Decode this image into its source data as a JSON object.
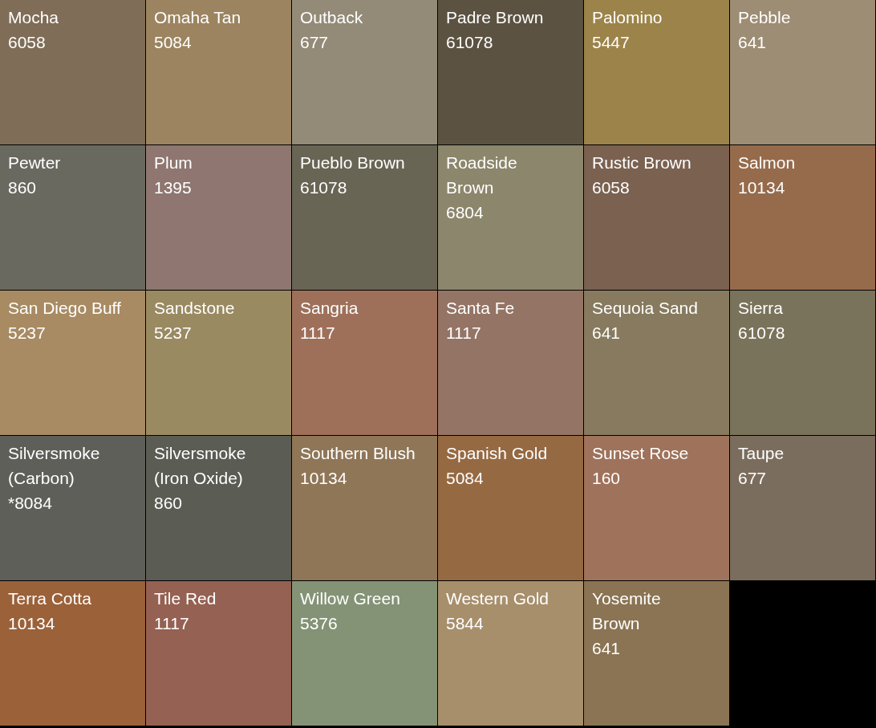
{
  "swatches": [
    {
      "name": "Mocha",
      "code": "6058",
      "color": "#7f6d57"
    },
    {
      "name": "Omaha Tan",
      "code": "5084",
      "color": "#9c8460"
    },
    {
      "name": "Outback",
      "code": "677",
      "color": "#938b78"
    },
    {
      "name": "Padre Brown",
      "code": "61078",
      "color": "#5b5241"
    },
    {
      "name": "Palomino",
      "code": "5447",
      "color": "#9c8349"
    },
    {
      "name": "Pebble",
      "code": "641",
      "color": "#9d8d74"
    },
    {
      "name": "Pewter",
      "code": "860",
      "color": "#6a6960"
    },
    {
      "name": "Plum",
      "code": "1395",
      "color": "#8f7670"
    },
    {
      "name": "Pueblo Brown",
      "code": "61078",
      "color": "#686554"
    },
    {
      "name": "Roadside Brown",
      "code": "6804",
      "color": "#8c866c"
    },
    {
      "name": "Rustic Brown",
      "code": "6058",
      "color": "#7b6150"
    },
    {
      "name": "Salmon",
      "code": "10134",
      "color": "#966b4b"
    },
    {
      "name": "San Diego Buff",
      "code": "5237",
      "color": "#a88b63"
    },
    {
      "name": "Sandstone",
      "code": "5237",
      "color": "#9a8a62"
    },
    {
      "name": "Sangria",
      "code": "1117",
      "color": "#9e705a"
    },
    {
      "name": "Santa Fe",
      "code": "1117",
      "color": "#947465"
    },
    {
      "name": "Sequoia Sand",
      "code": "641",
      "color": "#877a5f"
    },
    {
      "name": "Sierra",
      "code": "61078",
      "color": "#7a735b"
    },
    {
      "name": "Silversmoke (Carbon)",
      "code": "*8084",
      "color": "#5d5f58"
    },
    {
      "name": "Silversmoke (Iron Oxide)",
      "code": "860",
      "color": "#5b5c54"
    },
    {
      "name": "Southern Blush",
      "code": "10134",
      "color": "#8f7657"
    },
    {
      "name": "Spanish Gold",
      "code": "5084",
      "color": "#956942"
    },
    {
      "name": "Sunset Rose",
      "code": "160",
      "color": "#9e725b"
    },
    {
      "name": "Taupe",
      "code": "677",
      "color": "#7b6d5d"
    },
    {
      "name": "Terra Cotta",
      "code": "10134",
      "color": "#9b6139"
    },
    {
      "name": "Tile Red",
      "code": "1117",
      "color": "#946152"
    },
    {
      "name": "Willow Green",
      "code": "5376",
      "color": "#849375"
    },
    {
      "name": "Western Gold",
      "code": "5844",
      "color": "#a88f6c"
    },
    {
      "name": "Yosemite Brown",
      "code": "641",
      "color": "#8a7453"
    }
  ]
}
